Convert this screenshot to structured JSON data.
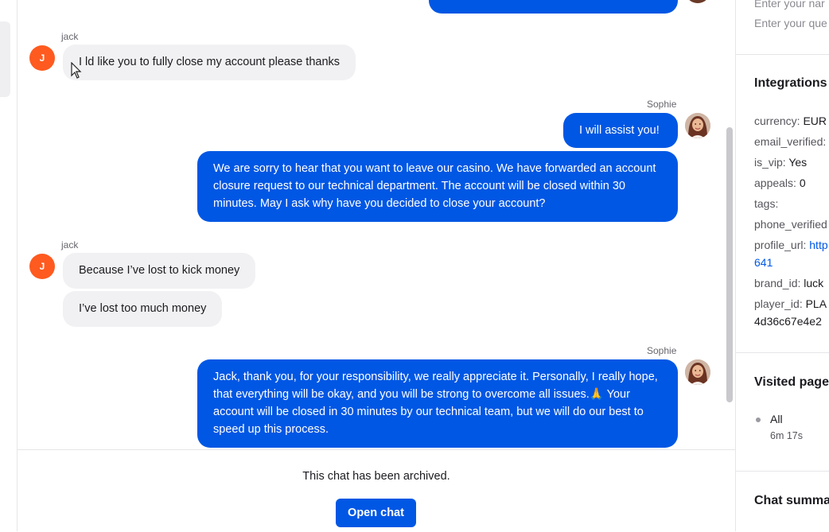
{
  "chat": {
    "messages": [
      {
        "sender": "jack",
        "avatar_initial": "J",
        "bubbles": [
          "I ld like you to fully close my account please thanks"
        ]
      },
      {
        "sender": "Sophie",
        "bubbles": [
          "I will assist you!",
          "We are sorry to hear that you want to leave our casino. We have forwarded an account closure request to our technical department. The account will be closed within 30 minutes. May I ask why have you decided to close your account?"
        ]
      },
      {
        "sender": "jack",
        "avatar_initial": "J",
        "bubbles": [
          "Because I’ve lost to kick money",
          "I’ve lost too much money"
        ]
      },
      {
        "sender": "Sophie",
        "bubbles": [
          "Jack, thank you, for your responsibility, we really appreciate it. Personally, I really hope, that everything will be okay, and you will be strong to overcome all issues.🙏 Your account will be closed in 30 minutes by our technical team, but we will do our best to speed up this process."
        ]
      }
    ]
  },
  "footer": {
    "archived_text": "This chat has been archived.",
    "open_chat_label": "Open chat"
  },
  "side": {
    "form": {
      "name_placeholder": "Enter your nar",
      "question_placeholder": "Enter your que"
    },
    "integrations": {
      "title": "Integrations",
      "rows": [
        {
          "key": "currency:",
          "value": "EUR"
        },
        {
          "key": "email_verified:",
          "value": ""
        },
        {
          "key": "is_vip:",
          "value": "Yes"
        },
        {
          "key": "appeals:",
          "value": "0"
        },
        {
          "key": "tags:",
          "value": ""
        },
        {
          "key": "phone_verified",
          "value": ""
        },
        {
          "key": "profile_url:",
          "value": "http",
          "value2": "641"
        },
        {
          "key": "brand_id:",
          "value": "luck"
        },
        {
          "key": "player_id:",
          "value": "PLA",
          "value2": "4d36c67e4e2"
        }
      ]
    },
    "visited": {
      "title": "Visited page",
      "item_label": "All",
      "item_duration": "6m 17s"
    },
    "summary": {
      "title": "Chat summa"
    }
  },
  "colors": {
    "accent": "#0057e4",
    "avatar_orange": "#ff5a1f",
    "incoming_bubble": "#f1f1f3"
  }
}
